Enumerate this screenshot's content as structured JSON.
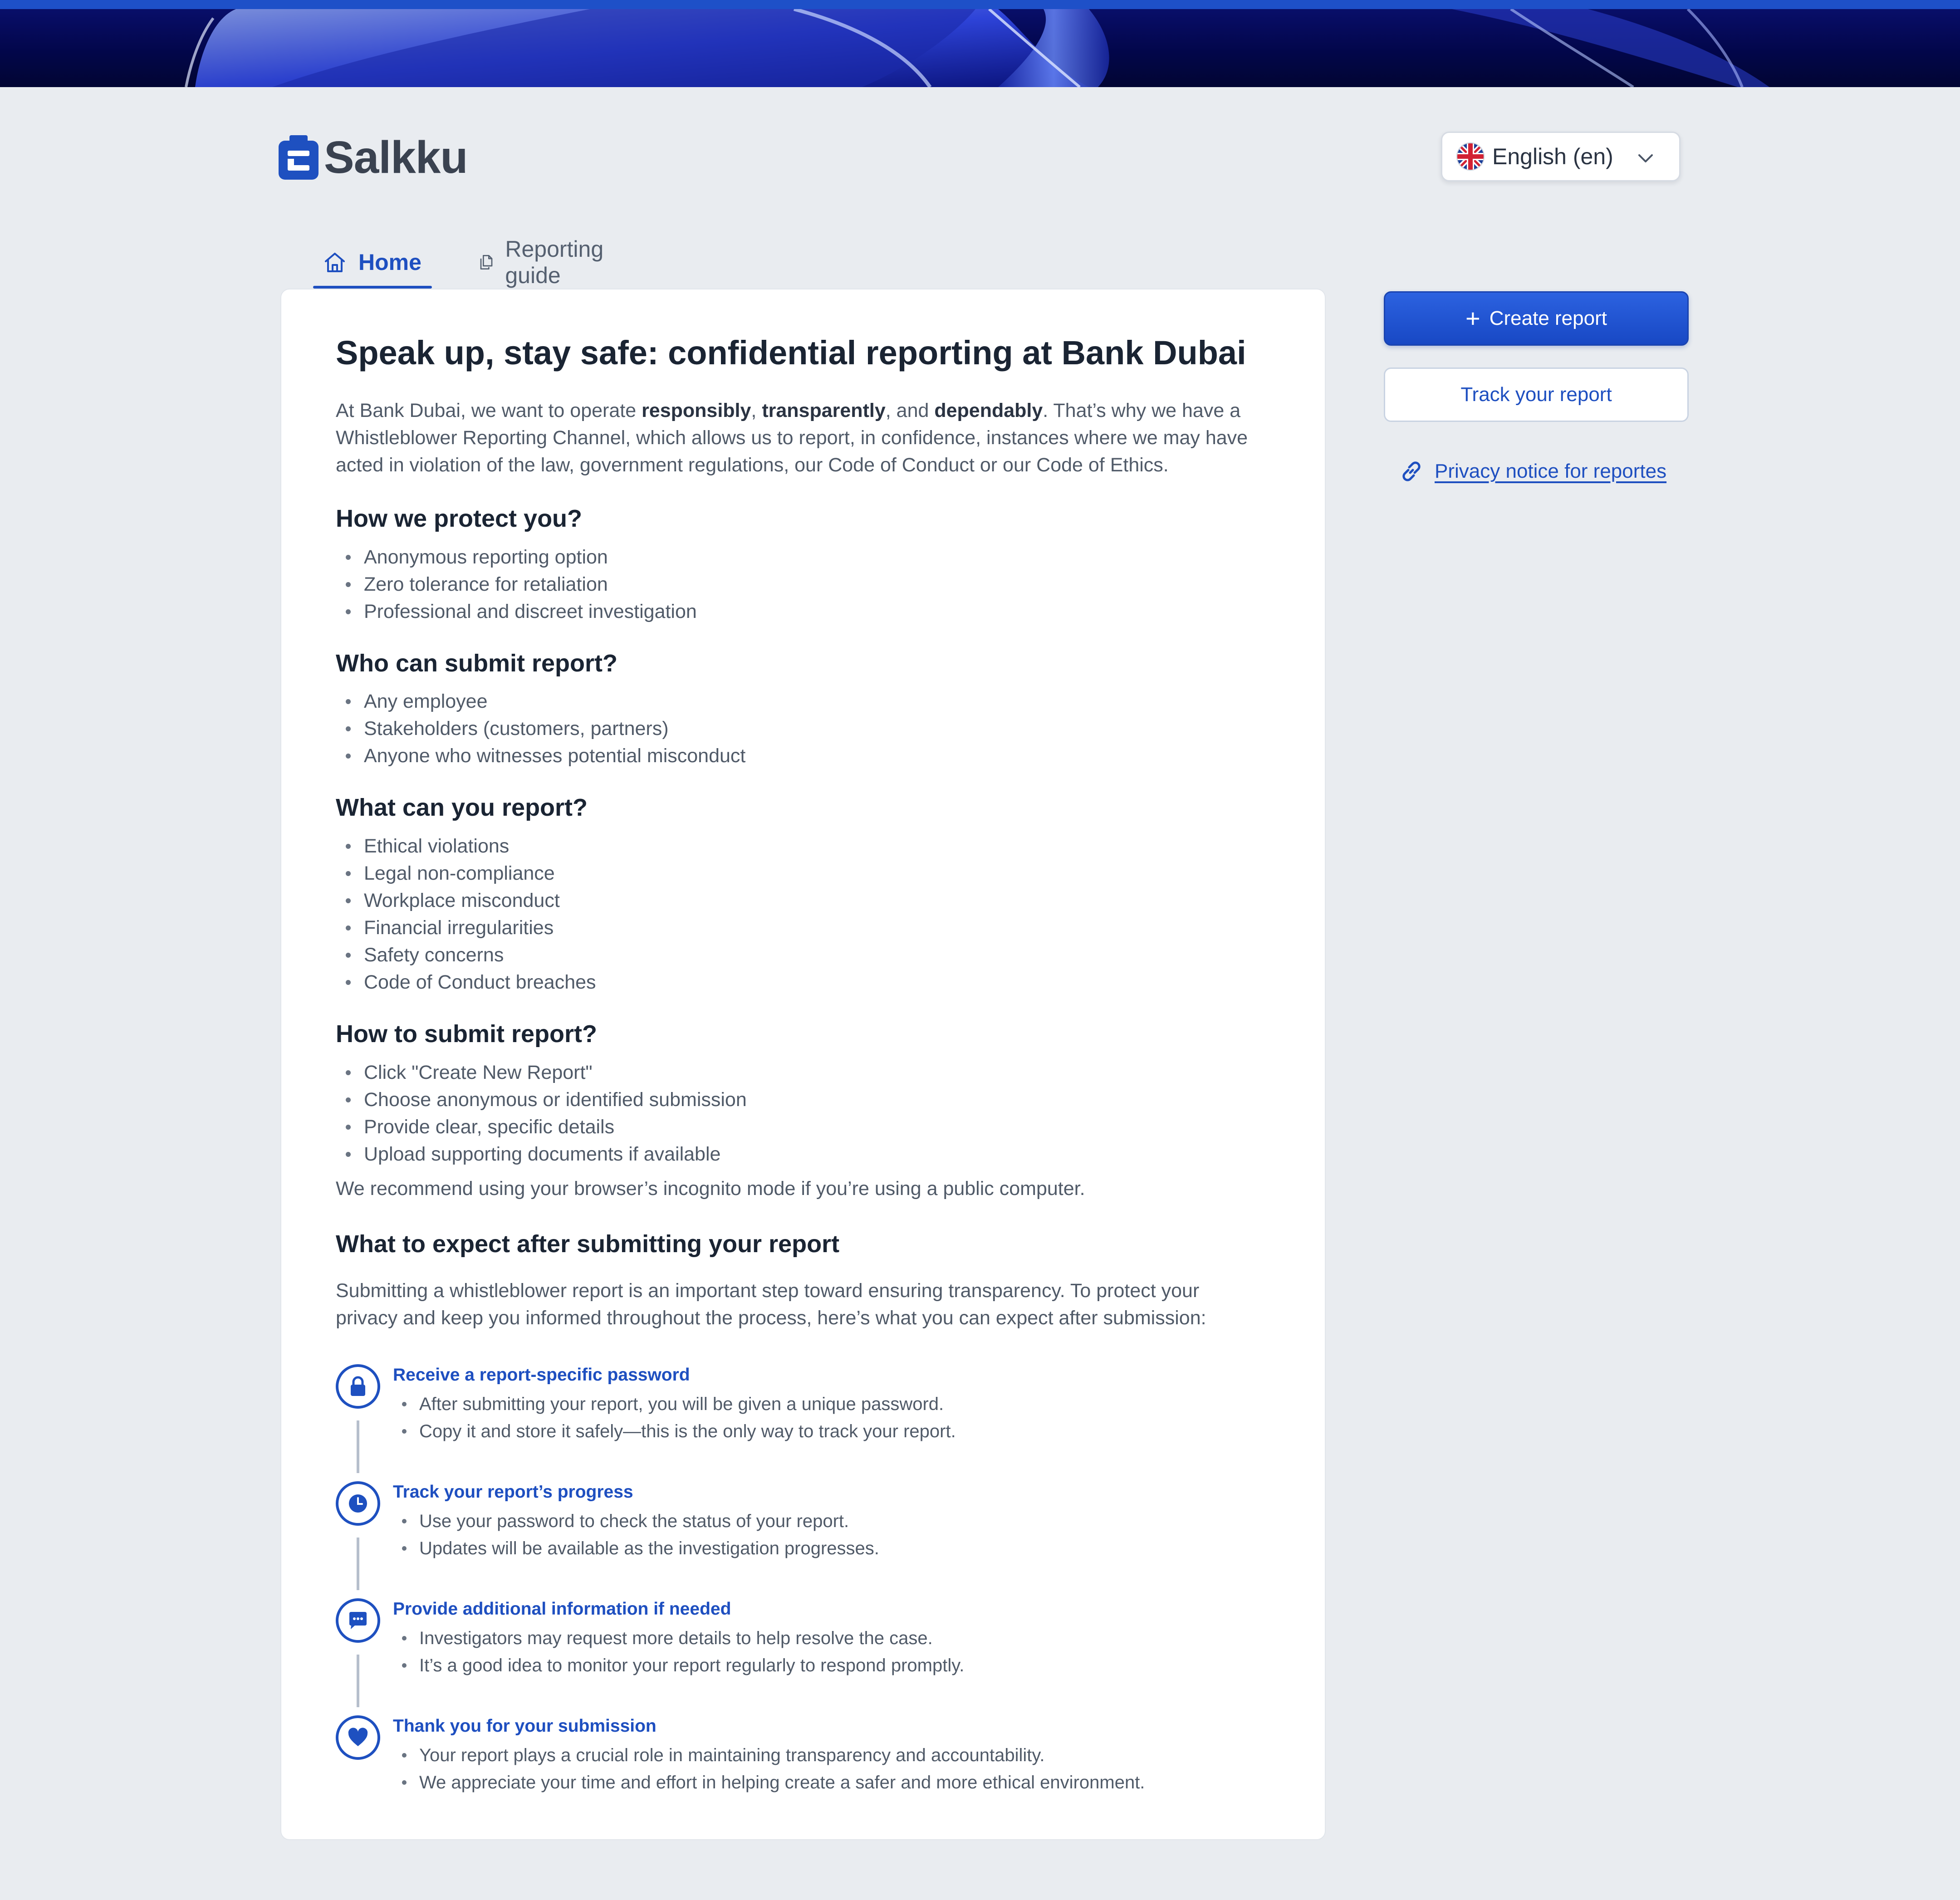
{
  "header": {
    "logo_text": "Salkku",
    "language": {
      "label": "English (en)",
      "icon": "uk-flag-icon"
    }
  },
  "nav": {
    "tabs": [
      {
        "label": "Home",
        "icon": "home-icon",
        "active": true
      },
      {
        "label": "Reporting guide",
        "icon": "document-icon",
        "active": false
      }
    ]
  },
  "main": {
    "title": "Speak up, stay safe: confidential reporting at Bank Dubai",
    "intro": {
      "p1": "At Bank Dubai, we want to operate ",
      "b1": "responsibly",
      "p2": ", ",
      "b2": "transparently",
      "p3": ", and ",
      "b3": "dependably",
      "p4": ". That’s why we have a Whistleblower Reporting Channel, which allows us to report, in confidence, instances where we may have acted in violation of the law, government regulations, our Code of Conduct or our Code of Ethics."
    },
    "sections": [
      {
        "heading": "How we protect you?",
        "items": [
          "Anonymous reporting option",
          "Zero tolerance for retaliation",
          "Professional and discreet investigation"
        ]
      },
      {
        "heading": "Who can submit report?",
        "items": [
          "Any employee",
          "Stakeholders (customers, partners)",
          "Anyone who witnesses potential misconduct"
        ]
      },
      {
        "heading": "What can you report?",
        "items": [
          "Ethical violations",
          "Legal non-compliance",
          "Workplace misconduct",
          "Financial irregularities",
          "Safety concerns",
          "Code of Conduct breaches"
        ]
      },
      {
        "heading": "How to submit report?",
        "items": [
          "Click \"Create New Report\"",
          "Choose anonymous or identified submission",
          "Provide clear, specific details",
          "Upload supporting documents if available"
        ]
      }
    ],
    "note": "We recommend using your browser’s incognito mode if you’re using a public computer.",
    "expect": {
      "heading": "What to expect after submitting your report",
      "paragraph": "Submitting a whistleblower report is an important step toward ensuring transparency. To protect your privacy and keep you informed throughout the process, here’s what you can expect after submission:",
      "steps": [
        {
          "title": "Receive a report-specific password",
          "icon": "lock-icon",
          "items": [
            "After submitting your report, you will be given a unique password.",
            "Copy it and store it safely—this is the only way to track your report."
          ]
        },
        {
          "title": "Track your report’s progress",
          "icon": "clock-icon",
          "items": [
            "Use your password to check the status of your report.",
            "Updates will be available as the investigation progresses."
          ]
        },
        {
          "title": "Provide additional information if needed",
          "icon": "chat-icon",
          "items": [
            "Investigators may request more details to help resolve the case.",
            "It’s a good idea to monitor your report regularly to respond promptly."
          ]
        },
        {
          "title": "Thank you for your submission",
          "icon": "heart-icon",
          "items": [
            "Your report plays a crucial role in maintaining transparency and accountability.",
            "We appreciate your time and effort in helping create a safer and more ethical environment."
          ]
        }
      ]
    }
  },
  "sidebar": {
    "create_label": "Create report",
    "track_label": "Track your report",
    "privacy_label": "Privacy notice for reportes"
  },
  "colors": {
    "accent": "#1e4fc0",
    "background": "#e9ecf0",
    "banner": "#02064a"
  }
}
